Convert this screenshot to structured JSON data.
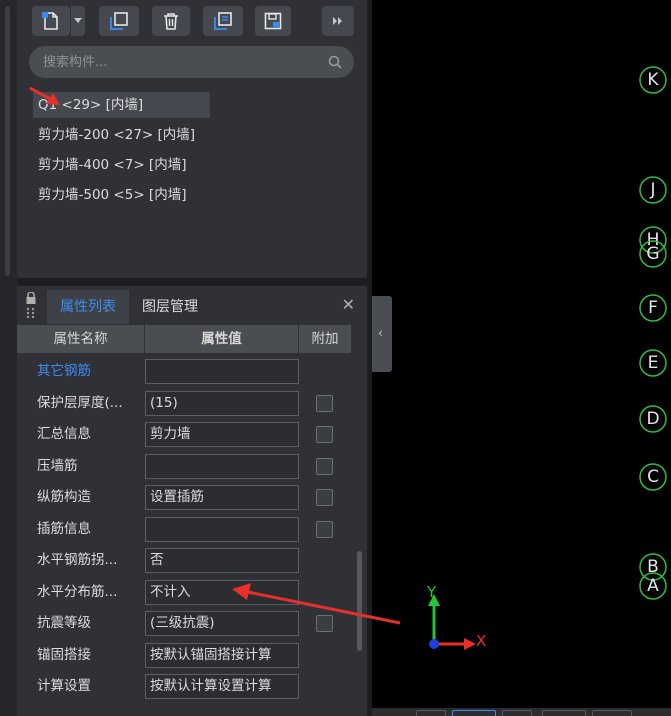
{
  "component_panel": {
    "search_placeholder": "搜索构件...",
    "components": [
      {
        "label": "Q1 <29> [内墙]",
        "selected": true
      },
      {
        "label": "剪力墙-200 <27> [内墙]",
        "selected": false
      },
      {
        "label": "剪力墙-400 <7> [内墙]",
        "selected": false
      },
      {
        "label": "剪力墙-500 <5> [内墙]",
        "selected": false
      }
    ]
  },
  "property_panel": {
    "tabs": [
      "属性列表",
      "图层管理"
    ],
    "active_tab": "属性列表",
    "headers": {
      "name": "属性名称",
      "value": "属性值",
      "extra": "附加"
    },
    "rows": [
      {
        "name": "其它钢筋",
        "value": "",
        "group": true,
        "checkbox": false
      },
      {
        "name": "保护层厚度(...",
        "value": "(15)",
        "group": false,
        "checkbox": true
      },
      {
        "name": "汇总信息",
        "value": "剪力墙",
        "group": false,
        "checkbox": true
      },
      {
        "name": "压墙筋",
        "value": "",
        "group": false,
        "checkbox": true
      },
      {
        "name": "纵筋构造",
        "value": "设置插筋",
        "group": false,
        "checkbox": true
      },
      {
        "name": "插筋信息",
        "value": "",
        "group": false,
        "checkbox": true
      },
      {
        "name": "水平钢筋拐...",
        "value": "否",
        "group": false,
        "checkbox": false
      },
      {
        "name": "水平分布筋...",
        "value": "不计入",
        "group": false,
        "checkbox": false
      },
      {
        "name": "抗震等级",
        "value": "(三级抗震)",
        "group": false,
        "checkbox": true
      },
      {
        "name": "锚固搭接",
        "value": "按默认锚固搭接计算",
        "group": false,
        "checkbox": false
      },
      {
        "name": "计算设置",
        "value": "按默认计算设置计算",
        "group": false,
        "checkbox": false
      }
    ]
  },
  "canvas": {
    "axis_labels": [
      "K",
      "J",
      "H",
      "G",
      "F",
      "E",
      "D",
      "C",
      "B",
      "A"
    ],
    "ucs": {
      "x_label": "X",
      "y_label": "Y"
    }
  },
  "colors": {
    "accent": "#3c8cf0",
    "annotation_arrow": "#e8302a",
    "axis_bubble": "#2fbf3a",
    "ucs_x": "#e8302a",
    "ucs_y": "#22c43a",
    "ucs_origin": "#1c3fe0"
  }
}
